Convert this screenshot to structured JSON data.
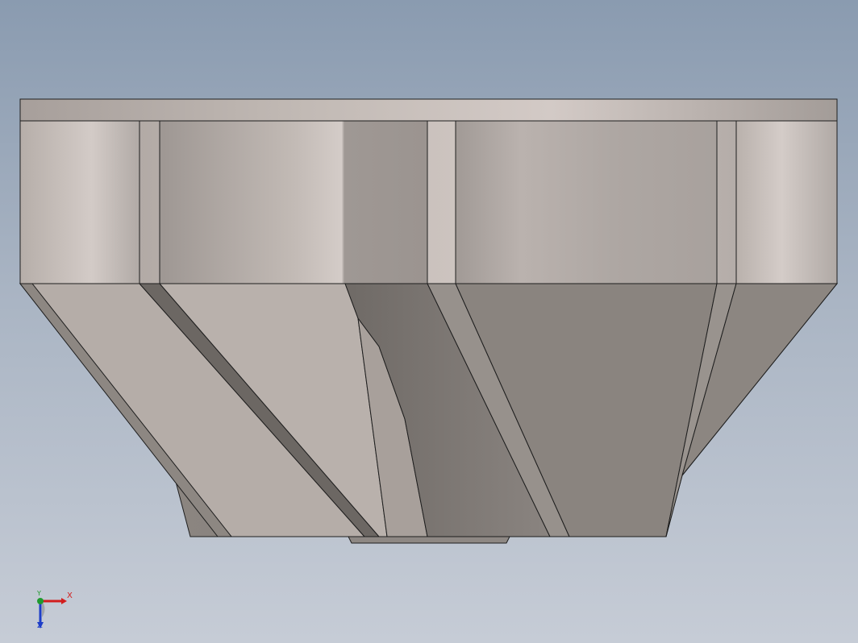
{
  "window": {
    "title": ""
  },
  "viewport": {
    "background_top": "#8a9bb0",
    "background_bottom": "#c6ccd6",
    "model_colors": {
      "light": "#cfc6c1",
      "mid": "#b2aba6",
      "dark": "#7d7873",
      "edge": "#1e1e1e"
    }
  },
  "triad": {
    "x_label": "X",
    "y_label": "Y",
    "z_label": "Z",
    "x_color": "#d21e1e",
    "y_color": "#1f9a2e",
    "z_color": "#1e3ec8"
  }
}
